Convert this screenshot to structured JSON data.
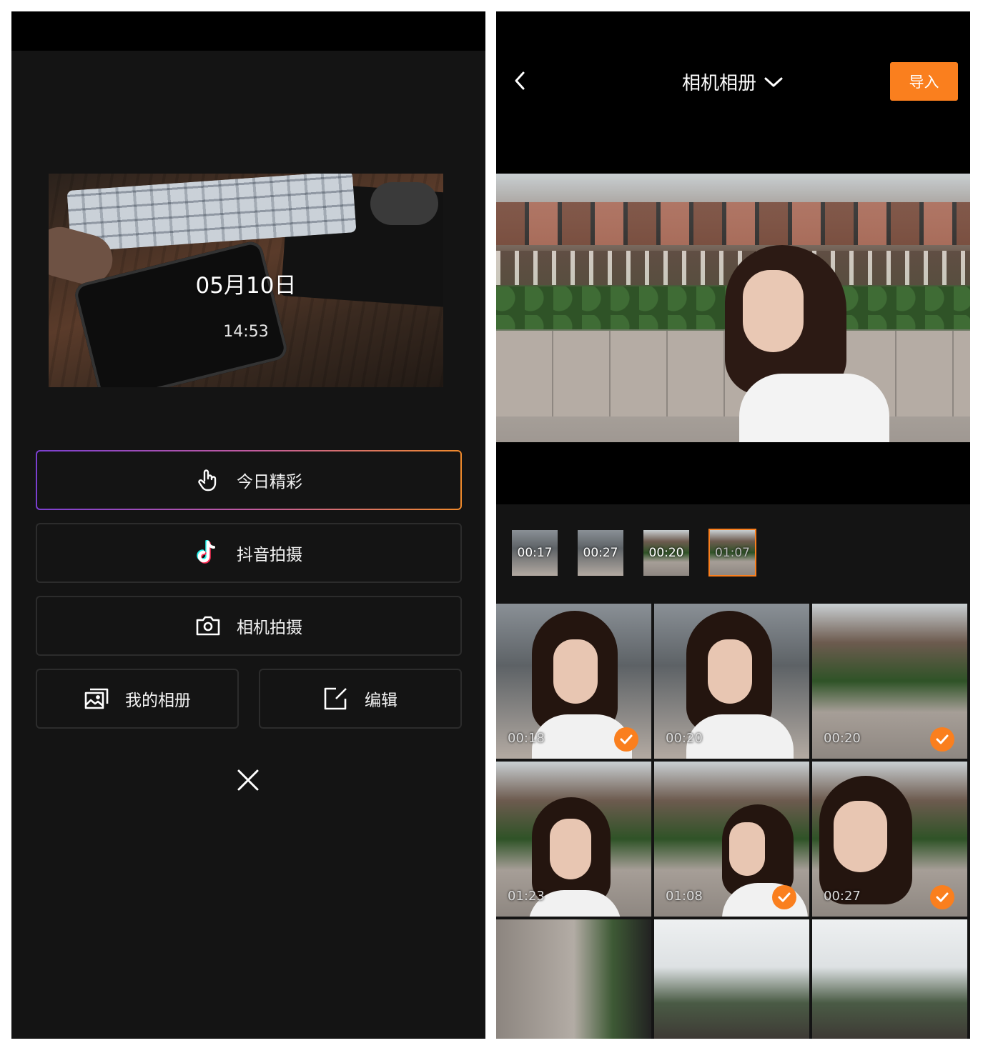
{
  "left": {
    "cover": {
      "date": "05月10日",
      "time": "14:53"
    },
    "buttons": {
      "today_highlights": "今日精彩",
      "douyin_shoot": "抖音拍摄",
      "camera_shoot": "相机拍摄",
      "my_album": "我的相册",
      "edit": "编辑"
    }
  },
  "right": {
    "album_title": "相机相册",
    "import_label": "导入",
    "selected_clips": [
      {
        "duration": "00:17",
        "selected": false
      },
      {
        "duration": "00:27",
        "selected": false
      },
      {
        "duration": "00:20",
        "selected": false
      },
      {
        "duration": "01:07",
        "selected": true
      }
    ],
    "grid": [
      {
        "duration": "00:18",
        "checked": true
      },
      {
        "duration": "00:20",
        "checked": false
      },
      {
        "duration": "00:20",
        "checked": true
      },
      {
        "duration": "01:23",
        "checked": false
      },
      {
        "duration": "01:08",
        "checked": true
      },
      {
        "duration": "00:27",
        "checked": true
      },
      {
        "duration": "",
        "checked": false
      },
      {
        "duration": "",
        "checked": false
      },
      {
        "duration": "",
        "checked": false
      }
    ]
  },
  "colors": {
    "accent": "#fa7f1e",
    "background": "#141414",
    "border": "#2c2c2c"
  }
}
